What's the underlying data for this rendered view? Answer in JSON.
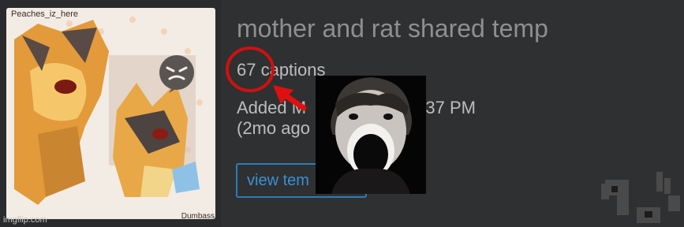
{
  "template": {
    "title": "mother and rat shared temp",
    "captions": "67 captions",
    "added_line1": "Added M",
    "added_time": "7:37 PM",
    "added_line2": "(2mo ago",
    "view_button": "view tem"
  },
  "thumbnail": {
    "watermark_top": "Peaches_iz_here",
    "watermark_bottom": "Dumbass"
  },
  "footer": {
    "site": "imgflip.com"
  },
  "annotation": {
    "circle_color": "#d01010",
    "arrow_color": "#e01010"
  },
  "colors": {
    "background": "#2f3032",
    "title": "#8f8f8f",
    "meta_text": "#bdbdbd",
    "button": "#2c7cbc"
  },
  "icons": [
    "angry-emoji-icon",
    "pixel-character-icon"
  ]
}
